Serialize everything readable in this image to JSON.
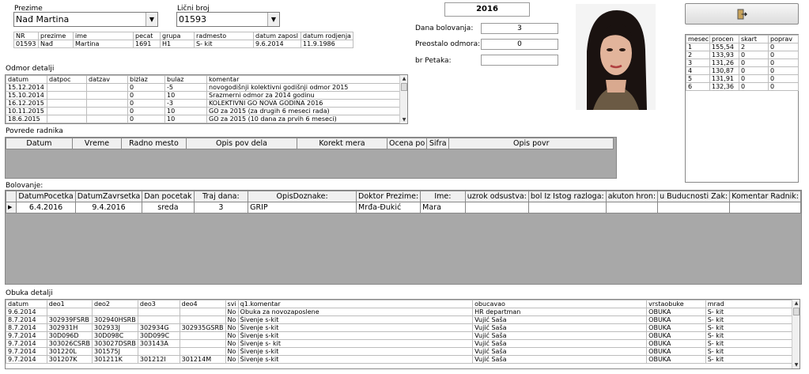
{
  "header": {
    "prezime_label": "Prezime",
    "prezime_value": "Nađ Martina",
    "licni_label": "Lični broj",
    "licni_value": "01593",
    "year": "2016"
  },
  "emp": {
    "cols": [
      "NR",
      "prezime",
      "ime",
      "pecat",
      "grupa",
      "radmesto",
      "datum zaposl",
      "datum rodjenja"
    ],
    "row": [
      "01593",
      "Nađ",
      "Martina",
      "1691",
      "H1",
      "S- kit",
      "9.6.2014",
      "11.9.1986"
    ]
  },
  "stats": {
    "dana_label": "Dana bolovanja:",
    "dana_value": "3",
    "preostalo_label": "Preostalo odmora:",
    "preostalo_value": "0",
    "petaka_label": "br Petaka:",
    "petaka_value": ""
  },
  "icons": {
    "exit": "exit-door-icon",
    "photo": "employee-photo"
  },
  "monthly": {
    "cols": [
      "mesec",
      "procen",
      "skart",
      "poprav"
    ],
    "rows": [
      [
        "1",
        "155,54",
        "2",
        "0"
      ],
      [
        "2",
        "133,93",
        "0",
        "0"
      ],
      [
        "3",
        "131,26",
        "0",
        "0"
      ],
      [
        "4",
        "130,87",
        "0",
        "0"
      ],
      [
        "5",
        "131,91",
        "0",
        "0"
      ],
      [
        "6",
        "132,36",
        "0",
        "0"
      ]
    ]
  },
  "odmor": {
    "title": "Odmor detalji",
    "cols": [
      "datum",
      "datpoc",
      "datzav",
      "bizlaz",
      "bulaz",
      "komentar"
    ],
    "rows": [
      [
        "15.12.2014",
        "",
        "",
        "0",
        "-5",
        "novogodišnji kolektivni godišnji odmor 2015"
      ],
      [
        "15.10.2014",
        "",
        "",
        "0",
        "10",
        "Srazmerni odmor za 2014 godinu"
      ],
      [
        "16.12.2015",
        "",
        "",
        "0",
        "-3",
        "KOLEKTIVNI GO NOVA GODINA 2016"
      ],
      [
        "10.11.2015",
        "",
        "",
        "0",
        "10",
        "GO za 2015 (za drugih 6 meseci rada)"
      ],
      [
        "18.6.2015",
        "",
        "",
        "0",
        "10",
        "GO za 2015 (10 dana za prvih 6 meseci)"
      ]
    ]
  },
  "povrede": {
    "title": "Povrede radnika",
    "cols": [
      "Datum",
      "Vreme",
      "Radno mesto",
      "Opis pov dela",
      "Korekt mera",
      "Ocena po",
      "Sifra",
      "Opis povr"
    ]
  },
  "bolovanje": {
    "title": "Bolovanje:",
    "cols": [
      "DatumPocetka",
      "DatumZavrsetka",
      "Dan pocetak",
      "Traj dana:",
      "OpisDoznake:",
      "Doktor Prezime:",
      "Ime:",
      "uzrok odsustva:",
      "bol Iz Istog razloga:",
      "akuton hron:",
      "u Buducnosti Zak:",
      "Komentar Radnik:"
    ],
    "row": [
      "6.4.2016",
      "9.4.2016",
      "sreda",
      "3",
      "GRIP",
      "Mrđa-Đukić",
      "Mara",
      "",
      "",
      "",
      "",
      ""
    ]
  },
  "obuka": {
    "title": "Obuka detalji",
    "cols": [
      "datum",
      "deo1",
      "deo2",
      "deo3",
      "deo4",
      "svi",
      "q1.komentar",
      "obucavao",
      "vrstaobuke",
      "mrad"
    ],
    "rows": [
      [
        "9.6.2014",
        "",
        "",
        "",
        "",
        "No",
        "Obuka za novozaposlene",
        "HR departman",
        "OBUKA",
        "S- kit"
      ],
      [
        "8.7.2014",
        "302939FSRB",
        "302940HSRB",
        "",
        "",
        "No",
        "Šivenje s-kit",
        "Vujić Saša",
        "OBUKA",
        "S- kit"
      ],
      [
        "8.7.2014",
        "302931H",
        "302933J",
        "302934G",
        "302935GSRB",
        "No",
        "Šivenje s-kit",
        "Vujić Saša",
        "OBUKA",
        "S- kit"
      ],
      [
        "9.7.2014",
        "30D096D",
        "30D098C",
        "30D099C",
        "",
        "No",
        "Šivenje s-kit",
        "Vujić Saša",
        "OBUKA",
        "S- kit"
      ],
      [
        "9.7.2014",
        "303026CSRB",
        "303027DSRB",
        "303143A",
        "",
        "No",
        "Šivenje s- kit",
        "Vujić Saša",
        "OBUKA",
        "S- kit"
      ],
      [
        "9.7.2014",
        "301220L",
        "301575J",
        "",
        "",
        "No",
        "Šivenje s-kit",
        "Vujić Saša",
        "OBUKA",
        "S- kit"
      ],
      [
        "9.7.2014",
        "301207K",
        "301211K",
        "301212I",
        "301214M",
        "No",
        "Šivenje s-kit",
        "Vujić Saša",
        "OBUKA",
        "S- kit"
      ]
    ]
  }
}
